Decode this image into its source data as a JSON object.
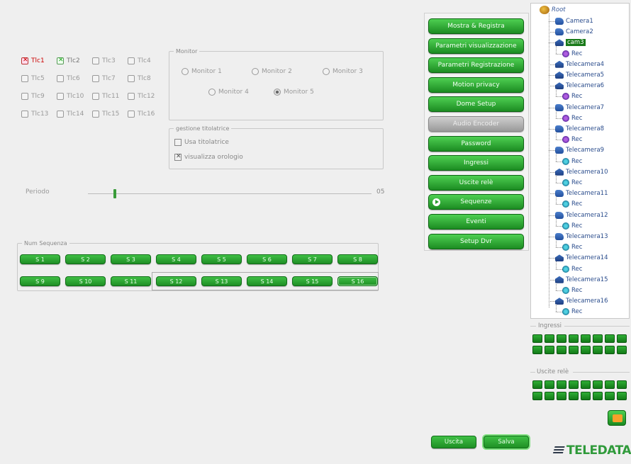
{
  "cameras": [
    {
      "label": "Tlc1",
      "state": "red"
    },
    {
      "label": "Tlc2",
      "state": "green"
    },
    {
      "label": "Tlc3",
      "state": "off"
    },
    {
      "label": "Tlc4",
      "state": "off"
    },
    {
      "label": "Tlc5",
      "state": "off"
    },
    {
      "label": "Tlc6",
      "state": "off"
    },
    {
      "label": "Tlc7",
      "state": "off"
    },
    {
      "label": "Tlc8",
      "state": "off"
    },
    {
      "label": "Tlc9",
      "state": "off"
    },
    {
      "label": "Tlc10",
      "state": "off"
    },
    {
      "label": "Tlc11",
      "state": "off"
    },
    {
      "label": "Tlc12",
      "state": "off"
    },
    {
      "label": "Tlc13",
      "state": "off"
    },
    {
      "label": "Tlc14",
      "state": "off"
    },
    {
      "label": "Tlc15",
      "state": "off"
    },
    {
      "label": "Tlc16",
      "state": "off"
    }
  ],
  "monitor": {
    "legend": "Monitor",
    "options": [
      "Monitor 1",
      "Monitor 2",
      "Monitor 3",
      "Monitor 4",
      "Monitor 5"
    ],
    "selected": "Monitor 5"
  },
  "titolatrice": {
    "legend": "gestione titolatrice",
    "usa_label": "Usa titolatrice",
    "orologio_label": "visualizza orologio"
  },
  "periodo": {
    "label": "Periodo",
    "value": "05",
    "level": 0.09
  },
  "sequenze": {
    "legend": "Num Sequenza",
    "row1": [
      "S 1",
      "S 2",
      "S 3",
      "S 4",
      "S 5",
      "S 6",
      "S 7",
      "S 8"
    ],
    "row2": [
      "S 9",
      "S 10",
      "S 11",
      "S 12",
      "S 13",
      "S 14",
      "S 15",
      "S 16"
    ]
  },
  "menu": [
    {
      "label": "Mostra & Registra",
      "disabled": false
    },
    {
      "label": "Parametri visualizzazione",
      "disabled": false
    },
    {
      "label": "Parametri Registrazione",
      "disabled": false
    },
    {
      "label": "Motion privacy",
      "disabled": false
    },
    {
      "label": "Dome Setup",
      "disabled": false
    },
    {
      "label": "Audio Encoder",
      "disabled": true
    },
    {
      "label": "Password",
      "disabled": false
    },
    {
      "label": "Ingressi",
      "disabled": false
    },
    {
      "label": "Uscite relè",
      "disabled": false
    },
    {
      "label": "Sequenze",
      "disabled": false
    },
    {
      "label": "Eventi",
      "disabled": false
    },
    {
      "label": "Setup Dvr",
      "disabled": false
    }
  ],
  "tree": {
    "root": "Root",
    "nodes": [
      {
        "label": "Camera1",
        "kind": "cam"
      },
      {
        "label": "Camera2",
        "kind": "cam"
      },
      {
        "label": "cam3",
        "kind": "dome",
        "selected": true
      },
      {
        "label": "Rec",
        "kind": "rec-purple"
      },
      {
        "label": "Telecamera4",
        "kind": "dome"
      },
      {
        "label": "Telecamera5",
        "kind": "dome"
      },
      {
        "label": "Telecamera6",
        "kind": "dome"
      },
      {
        "label": "Rec",
        "kind": "rec-purple"
      },
      {
        "label": "Telecamera7",
        "kind": "cam"
      },
      {
        "label": "Rec",
        "kind": "rec-purple"
      },
      {
        "label": "Telecamera8",
        "kind": "cam"
      },
      {
        "label": "Rec",
        "kind": "rec-purple"
      },
      {
        "label": "Telecamera9",
        "kind": "cam"
      },
      {
        "label": "Rec",
        "kind": "rec-teal"
      },
      {
        "label": "Telecamera10",
        "kind": "dome"
      },
      {
        "label": "Rec",
        "kind": "rec-teal"
      },
      {
        "label": "Telecamera11",
        "kind": "cam"
      },
      {
        "label": "Rec",
        "kind": "rec-teal"
      },
      {
        "label": "Telecamera12",
        "kind": "cam"
      },
      {
        "label": "Rec",
        "kind": "rec-teal"
      },
      {
        "label": "Telecamera13",
        "kind": "cam"
      },
      {
        "label": "Rec",
        "kind": "rec-teal"
      },
      {
        "label": "Telecamera14",
        "kind": "dome"
      },
      {
        "label": "Rec",
        "kind": "rec-teal"
      },
      {
        "label": "Telecamera15",
        "kind": "dome"
      },
      {
        "label": "Rec",
        "kind": "rec-teal"
      },
      {
        "label": "Telecamera16",
        "kind": "dome"
      },
      {
        "label": "Rec",
        "kind": "rec-teal"
      }
    ]
  },
  "ingressi_label": "Ingressi",
  "uscite_label": "Uscite relè",
  "footer": {
    "uscita_label": "Uscita",
    "salva_label": "Salva"
  },
  "logo_text": "TELEDATA",
  "colors": {
    "accent_green": "#2f9a3a",
    "selected_camera": "#cc0000"
  }
}
